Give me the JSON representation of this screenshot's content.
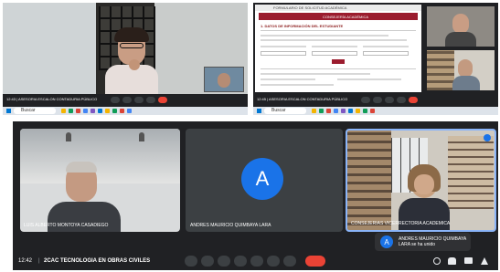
{
  "panel1": {
    "meeting_label": "12:43 | ASESORIA ESCALON CONTADURIA PÚBLICO",
    "taskbar_search": "Buscar"
  },
  "panel2": {
    "doc_title": "FORMULARIO DE SOLICITUD ACADÉMICA",
    "doc_subtitle": "CONSEJERÍA ACADÉMICA",
    "section_title": "1. DATOS DE INFORMACIÓN DEL ESTUDIANTE",
    "meeting_label": "12:45 | ASESORIA ESCALON CONTADURIA PÚBLICO",
    "taskbar_search": "Buscar"
  },
  "panel3": {
    "participants": [
      {
        "name": "LUIS ALBERTO MONTOYA CASADIEGO"
      },
      {
        "name": "ANDRES MAURICIO QUIMBAYA LARA",
        "initial": "A"
      },
      {
        "name": "CONSEJERIAS VICERRECTORIA ACADEMICA"
      }
    ],
    "toast": {
      "initial": "A",
      "text": "ANDRES MAURICIO QUIMBAYA LARA se ha unido"
    },
    "time": "12:42",
    "meeting_name": "2CAC TECNOLOGIA EN OBRAS CIVILES"
  },
  "colors": {
    "meet_bg": "#202124",
    "avatar_blue": "#1a73e8",
    "end_call_red": "#ea4335",
    "active_border": "#8ab4f8"
  }
}
